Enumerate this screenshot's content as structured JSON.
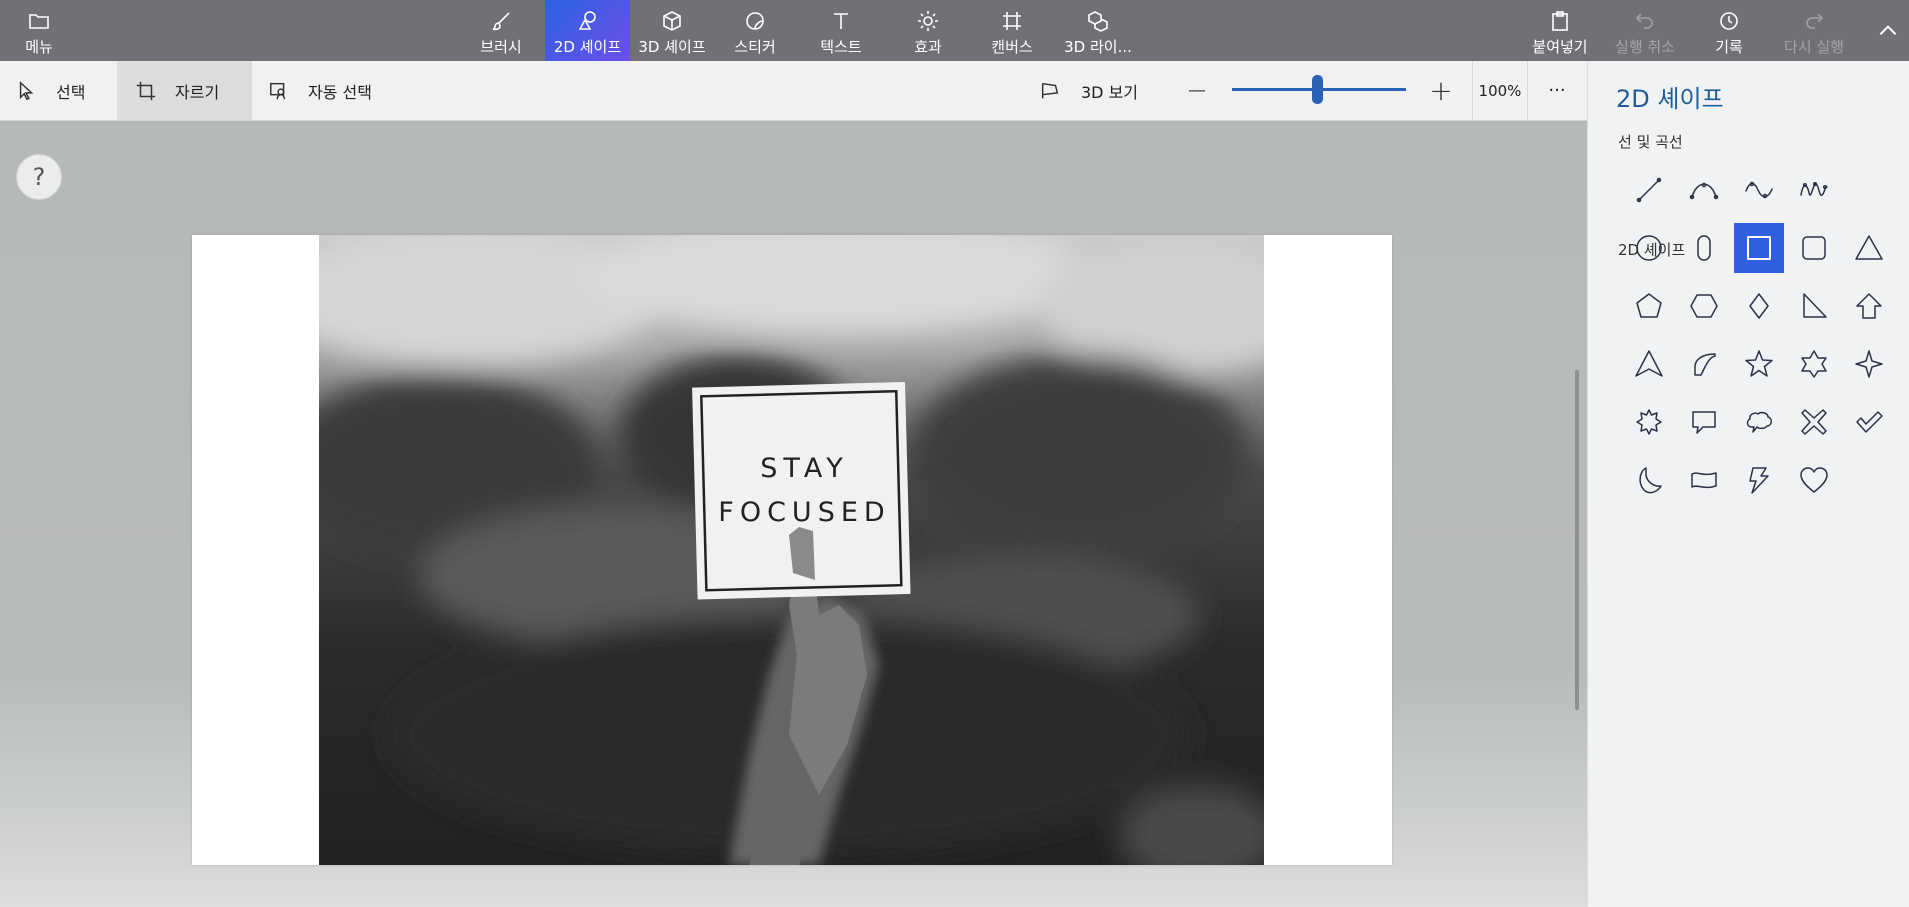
{
  "ribbon": {
    "menu_label": "메뉴",
    "tools": [
      {
        "label": "브러시",
        "icon": "brush-icon"
      },
      {
        "label": "2D 셰이프",
        "icon": "2d-shapes-icon",
        "active": true
      },
      {
        "label": "3D 셰이프",
        "icon": "3d-shapes-icon"
      },
      {
        "label": "스티커",
        "icon": "stickers-icon"
      },
      {
        "label": "텍스트",
        "icon": "text-icon"
      },
      {
        "label": "효과",
        "icon": "effects-icon"
      },
      {
        "label": "캔버스",
        "icon": "canvas-icon"
      },
      {
        "label": "3D 라이...",
        "icon": "3d-library-icon"
      }
    ],
    "paste_label": "붙여넣기",
    "undo_label": "실행 취소",
    "history_label": "기록",
    "redo_label": "다시 실행"
  },
  "toolbar": {
    "select_label": "선택",
    "crop_label": "자르기",
    "magic_select_label": "자동 선택",
    "view3d_label": "3D 보기",
    "zoom_minus": "—",
    "zoom_plus": "+",
    "zoom_value": "100%",
    "more": "···",
    "zoom_slider_fraction": 0.5
  },
  "canvas": {
    "help": "?",
    "card_line1": "STAY",
    "card_line2": "FOCUSED"
  },
  "panel": {
    "title": "2D 셰이프",
    "lines_section": "선 및 곡선",
    "shapes_section": "2D 셰이프",
    "lines": [
      "line-icon",
      "curve-icon",
      "two-point-curve-icon",
      "three-point-curve-icon"
    ],
    "shapes": [
      "circle-icon",
      "pill-icon",
      "square-icon",
      "rounded-square-icon",
      "triangle-icon",
      "pentagon-icon",
      "hexagon-icon",
      "diamond-icon",
      "right-triangle-icon",
      "arrow-up-icon",
      "arrowhead-icon",
      "quarter-circle-icon",
      "five-point-star-icon",
      "six-point-star-icon",
      "four-point-star-icon",
      "burst-icon",
      "speech-bubble-icon",
      "thought-bubble-icon",
      "x-shape-icon",
      "checkmark-icon",
      "crescent-moon-icon",
      "banner-icon",
      "lightning-icon",
      "heart-icon"
    ],
    "selected_shape": "square-icon"
  },
  "colors": {
    "ribbon_bg": "#6f7176",
    "active_tool_gradient": [
      "#2a62e6",
      "#6f4ee7"
    ],
    "accent": "#2a63b6",
    "selected_shape": "#2f5fe0"
  }
}
